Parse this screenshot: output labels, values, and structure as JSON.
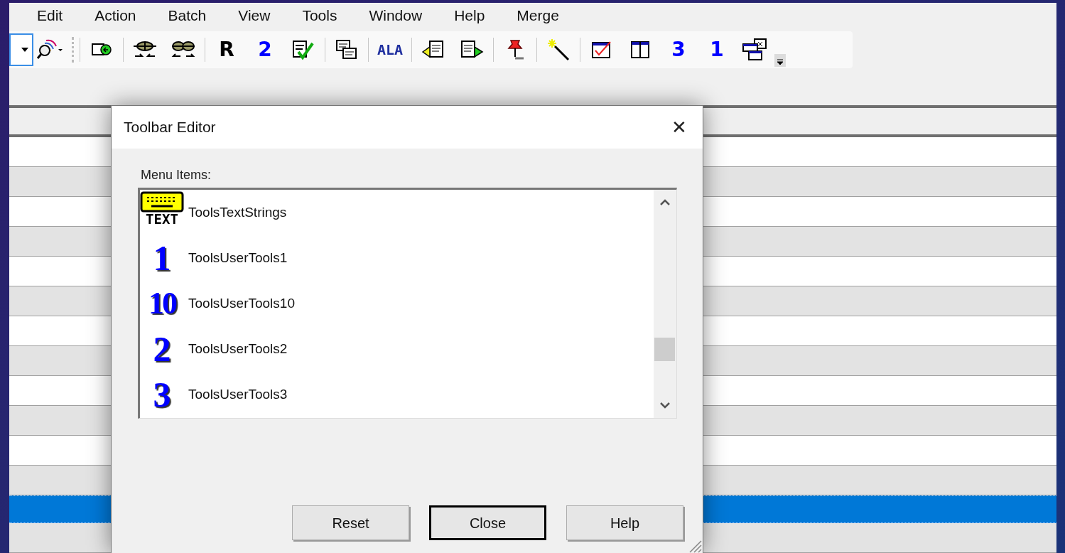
{
  "menu": [
    "Edit",
    "Action",
    "Batch",
    "View",
    "Tools",
    "Window",
    "Help",
    "Merge"
  ],
  "toolbar": [
    {
      "kind": "combo"
    },
    {
      "kind": "icon"
    },
    {
      "kind": "grip"
    },
    {
      "kind": "separator"
    },
    {
      "kind": "icon"
    },
    {
      "kind": "separator"
    },
    {
      "kind": "icon"
    },
    {
      "kind": "icon"
    },
    {
      "kind": "separator"
    },
    {
      "kind": "glyph",
      "text": "R",
      "color": "#000000"
    },
    {
      "kind": "glyph",
      "text": "2",
      "color": "#0000ff"
    },
    {
      "kind": "icon"
    },
    {
      "kind": "separator"
    },
    {
      "kind": "icon"
    },
    {
      "kind": "separator"
    },
    {
      "kind": "glyph",
      "text": "ALA",
      "color": "#1f2f9f"
    },
    {
      "kind": "separator"
    },
    {
      "kind": "icon"
    },
    {
      "kind": "icon"
    },
    {
      "kind": "separator"
    },
    {
      "kind": "icon"
    },
    {
      "kind": "separator"
    },
    {
      "kind": "icon"
    },
    {
      "kind": "separator"
    },
    {
      "kind": "icon"
    },
    {
      "kind": "icon"
    },
    {
      "kind": "glyph",
      "text": "3",
      "color": "#0000ff"
    },
    {
      "kind": "glyph",
      "text": "1",
      "color": "#0000ff"
    },
    {
      "kind": "icon"
    },
    {
      "kind": "overflow"
    }
  ],
  "grid": {
    "rows": [
      {
        "selected": false
      },
      {
        "selected": false
      },
      {
        "selected": false
      },
      {
        "selected": false
      },
      {
        "selected": false
      },
      {
        "selected": false
      },
      {
        "selected": false
      },
      {
        "selected": false
      },
      {
        "selected": false
      },
      {
        "selected": false
      },
      {
        "selected": false
      },
      {
        "selected": false
      },
      {
        "selected": true
      },
      {
        "selected": false
      }
    ]
  },
  "dialog": {
    "title": "Toolbar Editor",
    "close_glyph": "✕",
    "list_label": "Menu Items:",
    "items": [
      {
        "kind": "keyboard",
        "glyph": "TEXT",
        "label": "ToolsTextStrings"
      },
      {
        "kind": "number",
        "glyph": "1",
        "label": "ToolsUserTools1"
      },
      {
        "kind": "number",
        "glyph": "10",
        "label": "ToolsUserTools10"
      },
      {
        "kind": "number",
        "glyph": "2",
        "label": "ToolsUserTools2"
      },
      {
        "kind": "number",
        "glyph": "3",
        "label": "ToolsUserTools3"
      }
    ],
    "buttons": [
      {
        "label": "Reset",
        "default": false
      },
      {
        "label": "Close",
        "default": true
      },
      {
        "label": "Help",
        "default": false
      }
    ]
  }
}
